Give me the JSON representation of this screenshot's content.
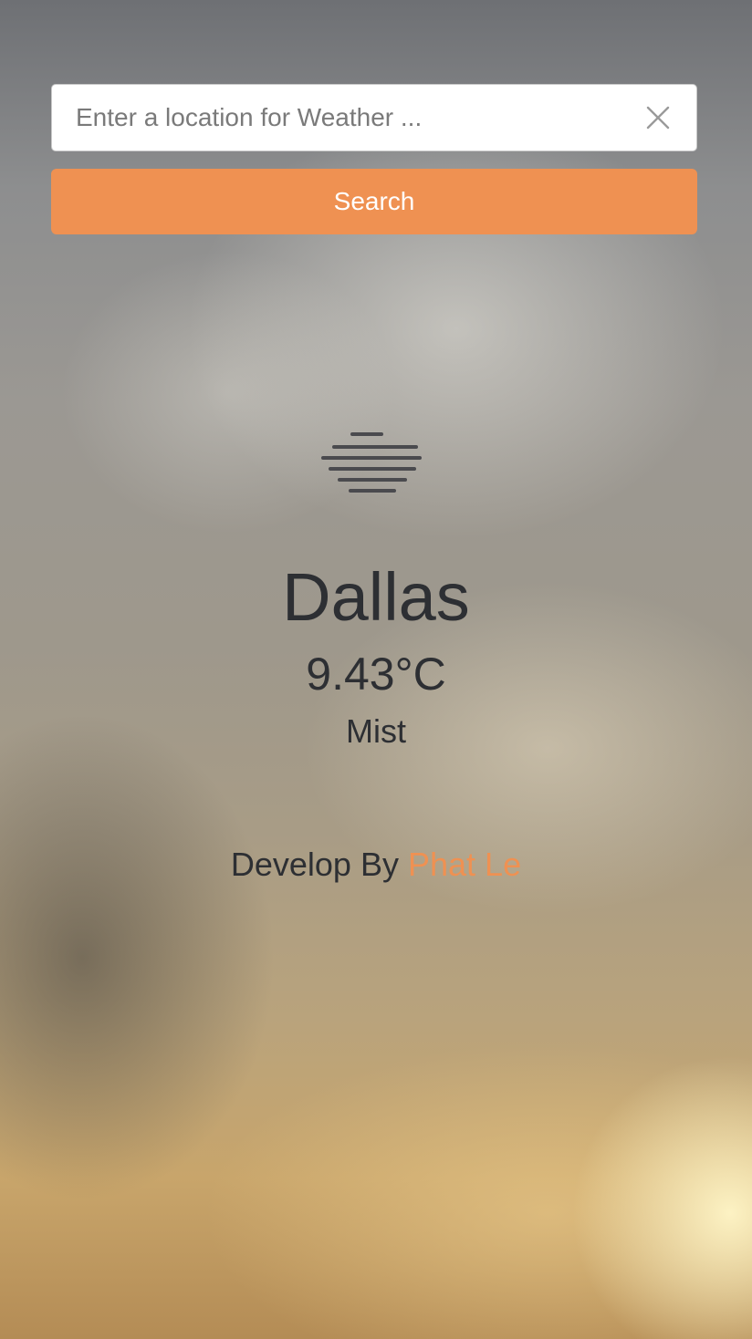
{
  "search": {
    "placeholder": "Enter a location for Weather ...",
    "value": "",
    "button_label": "Search",
    "clear_icon": "close-icon"
  },
  "weather": {
    "icon": "mist-icon",
    "city": "Dallas",
    "temperature": "9.43°C",
    "condition": "Mist"
  },
  "footer": {
    "prefix": "Develop By",
    "author": "Phat Le"
  },
  "colors": {
    "accent": "#ef9152",
    "text": "#2d2f33",
    "input_bg": "#ffffff"
  }
}
